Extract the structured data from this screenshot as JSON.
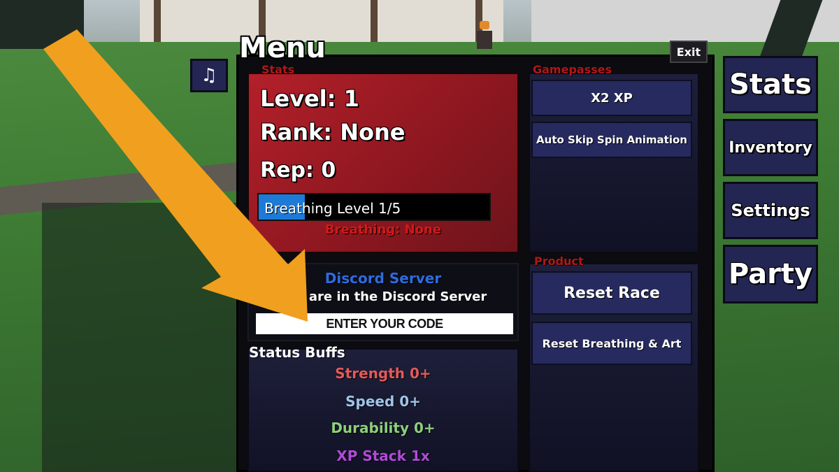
{
  "menu": {
    "title": "Menu",
    "exit_label": "Exit"
  },
  "music_button": {
    "icon": "music-note-icon",
    "glyph": "♫"
  },
  "stats": {
    "section_label": "Stats",
    "level": "Level: 1",
    "rank": "Rank: None",
    "rep": "Rep: 0",
    "breathing_level": "Breathing Level 1/5",
    "breathing_progress": 0.2,
    "breathing": "Breathing: None"
  },
  "discord": {
    "title": "Discord Server",
    "subtitle": "des are in the Discord Server",
    "code_placeholder": "ENTER YOUR CODE"
  },
  "buffs": {
    "label": "Status Buffs",
    "strength": "Strength 0+",
    "speed": "Speed 0+",
    "durability": "Durability 0+",
    "xp_stack": "XP Stack 1x"
  },
  "gamepasses": {
    "section_label": "Gamepasses",
    "items": [
      "X2 XP",
      "Auto Skip Spin Animation"
    ]
  },
  "product": {
    "section_label": "Product",
    "items": [
      "Reset Race",
      "Reset Breathing & Art"
    ]
  },
  "side_nav": [
    "Stats",
    "Inventory",
    "Settings",
    "Party"
  ],
  "colors": {
    "stats_card": "#b3202a",
    "button": "#262a5e",
    "arrow": "#f0a01e",
    "discord": "#2f6be0"
  }
}
